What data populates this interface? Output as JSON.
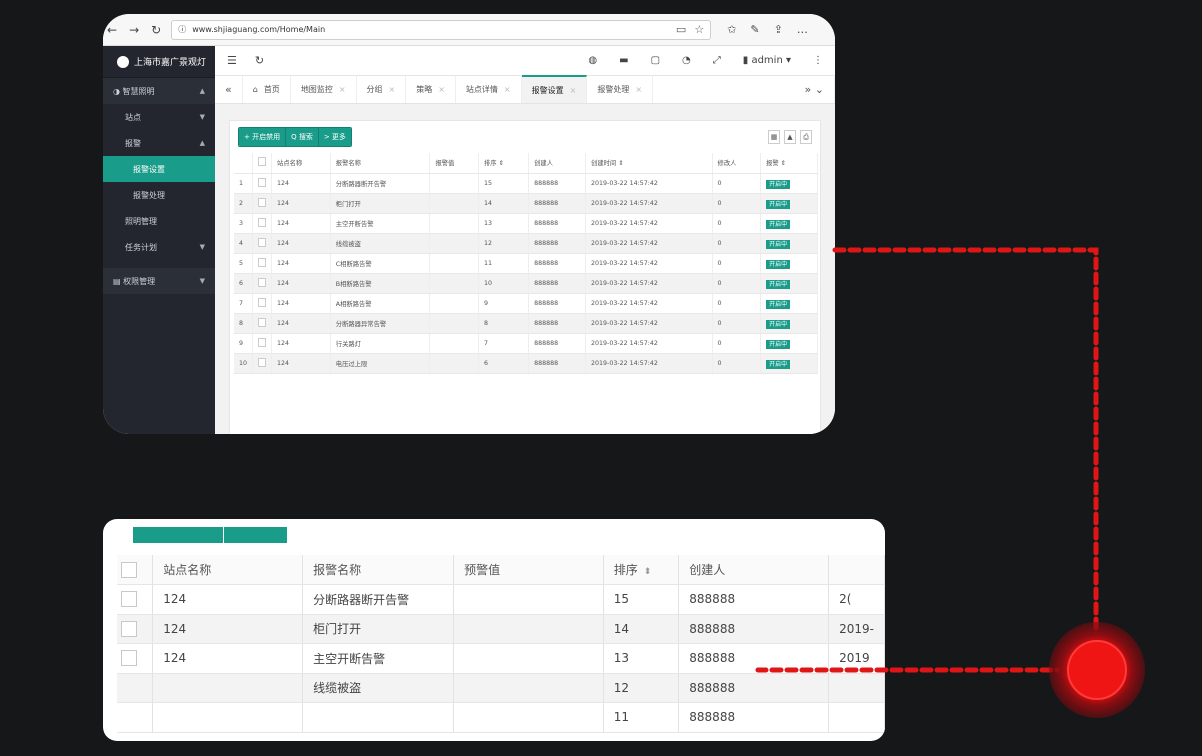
{
  "browser": {
    "url": "www.shjiaguang.com/Home/Main"
  },
  "sidebar": {
    "title": "上海市嘉广景观灯",
    "items": [
      {
        "label": "智慧照明",
        "type": "group",
        "caret": "▲"
      },
      {
        "label": "站点",
        "type": "sub",
        "caret": "▼"
      },
      {
        "label": "报警",
        "type": "sub",
        "caret": "▲"
      },
      {
        "label": "报警设置",
        "type": "subsub-active",
        "caret": ""
      },
      {
        "label": "报警处理",
        "type": "subsub",
        "caret": ""
      },
      {
        "label": "照明管理",
        "type": "sub",
        "caret": ""
      },
      {
        "label": "任务计划",
        "type": "sub",
        "caret": "▼"
      },
      {
        "label": "权限管理",
        "type": "group2",
        "caret": "▼"
      }
    ]
  },
  "topbar": {
    "user": "admin"
  },
  "tabs": [
    {
      "label": "首页"
    },
    {
      "label": "地图监控"
    },
    {
      "label": "分组"
    },
    {
      "label": "策略"
    },
    {
      "label": "站点详情"
    },
    {
      "label": "报警设置",
      "active": true
    },
    {
      "label": "报警处理"
    }
  ],
  "toolbar": {
    "add": "+ 开启禁用",
    "search": "Q 搜索",
    "more": "> 更多"
  },
  "small_table": {
    "headers": [
      "",
      "",
      "站点名称",
      "报警名称",
      "报警值",
      "排序 ⇕",
      "创建人",
      "创建时间 ⇕",
      "修改人",
      "报警 ⇕"
    ],
    "rows": [
      [
        "1",
        "124",
        "分断路器断开告警",
        "",
        "15",
        "888888",
        "2019-03-22 14:57:42",
        "0",
        "开启中"
      ],
      [
        "2",
        "124",
        "柜门打开",
        "",
        "14",
        "888888",
        "2019-03-22 14:57:42",
        "0",
        "开启中"
      ],
      [
        "3",
        "124",
        "主空开断告警",
        "",
        "13",
        "888888",
        "2019-03-22 14:57:42",
        "0",
        "开启中"
      ],
      [
        "4",
        "124",
        "线缆被盗",
        "",
        "12",
        "888888",
        "2019-03-22 14:57:42",
        "0",
        "开启中"
      ],
      [
        "5",
        "124",
        "C相断路告警",
        "",
        "11",
        "888888",
        "2019-03-22 14:57:42",
        "0",
        "开启中"
      ],
      [
        "6",
        "124",
        "B相断路告警",
        "",
        "10",
        "888888",
        "2019-03-22 14:57:42",
        "0",
        "开启中"
      ],
      [
        "7",
        "124",
        "A相断路告警",
        "",
        "9",
        "888888",
        "2019-03-22 14:57:42",
        "0",
        "开启中"
      ],
      [
        "8",
        "124",
        "分断路器异常告警",
        "",
        "8",
        "888888",
        "2019-03-22 14:57:42",
        "0",
        "开启中"
      ],
      [
        "9",
        "124",
        "行关路灯",
        "",
        "7",
        "888888",
        "2019-03-22 14:57:42",
        "0",
        "开启中"
      ],
      [
        "10",
        "124",
        "电压过上限",
        "",
        "6",
        "888888",
        "2019-03-22 14:57:42",
        "0",
        "开启中"
      ]
    ]
  },
  "big_table": {
    "headers": [
      "站点名称",
      "报警名称",
      "预警值",
      "排序",
      "创建人"
    ],
    "rows": [
      [
        "124",
        "分断路器断开告警",
        "",
        "15",
        "888888",
        "2("
      ],
      [
        "124",
        "柜门打开",
        "",
        "14",
        "888888",
        "2019-"
      ],
      [
        "124",
        "主空开断告警",
        "",
        "13",
        "888888",
        "2019"
      ],
      [
        "",
        "线缆被盗",
        "",
        "12",
        "888888",
        ""
      ],
      [
        "",
        "",
        "",
        "11",
        "888888",
        ""
      ]
    ]
  },
  "colors": {
    "accent": "#1a9c8a",
    "sidebar": "#23262e",
    "background": "#161719",
    "highlight": "#e60d0d"
  }
}
